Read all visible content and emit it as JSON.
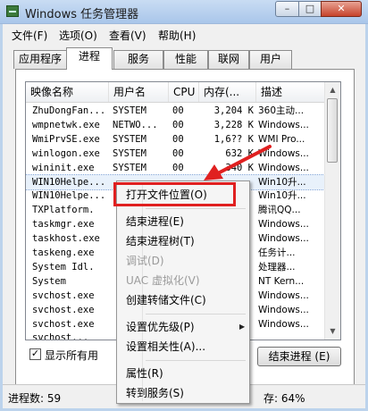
{
  "window": {
    "title": "Windows 任务管理器",
    "min": "–",
    "max": "□",
    "close": "✕"
  },
  "menubar": [
    "文件(F)",
    "选项(O)",
    "查看(V)",
    "帮助(H)"
  ],
  "tabs": [
    "应用程序",
    "进程",
    "服务",
    "性能",
    "联网",
    "用户"
  ],
  "columns": [
    "映像名称",
    "用户名",
    "CPU",
    "内存(...",
    "描述"
  ],
  "rows": [
    [
      "ZhuDongFan...",
      "SYSTEM",
      "00",
      "3,204 K",
      "360主动..."
    ],
    [
      "wmpnetwk.exe",
      "NETWO...",
      "00",
      "3,228 K",
      "Windows..."
    ],
    [
      "WmiPrvSE.exe",
      "SYSTEM",
      "00",
      "1,6?? K",
      "WMI Pro..."
    ],
    [
      "winlogon.exe",
      "SYSTEM",
      "00",
      "632 K",
      "Windows..."
    ],
    [
      "wininit.exe",
      "SYSTEM",
      "00",
      "340 K",
      "Windows..."
    ],
    [
      "WIN10Helpe...",
      "",
      "",
      "",
      "Win10升..."
    ],
    [
      "WIN10Helpe...",
      "",
      "",
      "",
      "Win10升..."
    ],
    [
      "TXPlatform.",
      "",
      "",
      "",
      "腾讯QQ..."
    ],
    [
      "taskmgr.exe",
      "",
      "",
      "",
      "Windows..."
    ],
    [
      "taskhost.exe",
      "",
      "",
      "",
      "Windows..."
    ],
    [
      "taskeng.exe",
      "",
      "",
      "",
      "任务计..."
    ],
    [
      "System Idl.",
      "",
      "",
      "",
      "处理器..."
    ],
    [
      "System",
      "",
      "",
      "",
      "NT Kern..."
    ],
    [
      "svchost.exe",
      "",
      "",
      "",
      "Windows..."
    ],
    [
      "svchost.exe",
      "",
      "",
      "",
      "Windows..."
    ],
    [
      "svchost.exe",
      "",
      "",
      "",
      "Windows..."
    ],
    [
      "svchost...",
      "",
      "",
      "",
      ""
    ]
  ],
  "context_menu": {
    "items": [
      {
        "label": "打开文件位置(O)",
        "disabled": false
      },
      {
        "label": "结束进程(E)",
        "disabled": false
      },
      {
        "label": "结束进程树(T)",
        "disabled": false
      },
      {
        "label": "调试(D)",
        "disabled": true
      },
      {
        "label": "UAC 虚拟化(V)",
        "disabled": true
      },
      {
        "label": "创建转储文件(C)",
        "disabled": false
      },
      {
        "label": "设置优先级(P)",
        "disabled": false
      },
      {
        "label": "设置相关性(A)...",
        "disabled": false
      },
      {
        "label": "属性(R)",
        "disabled": false
      },
      {
        "label": "转到服务(S)",
        "disabled": false
      }
    ],
    "submenu_arrow": "▶"
  },
  "show_all_label": "显示所有用",
  "show_all_checked": "✓",
  "end_process_button": "结束进程 (E)",
  "status": {
    "processes": "进程数: 59",
    "memory": "存: 64%"
  },
  "colors": {
    "highlight_box": "#e02020",
    "arrow": "#e02020"
  }
}
